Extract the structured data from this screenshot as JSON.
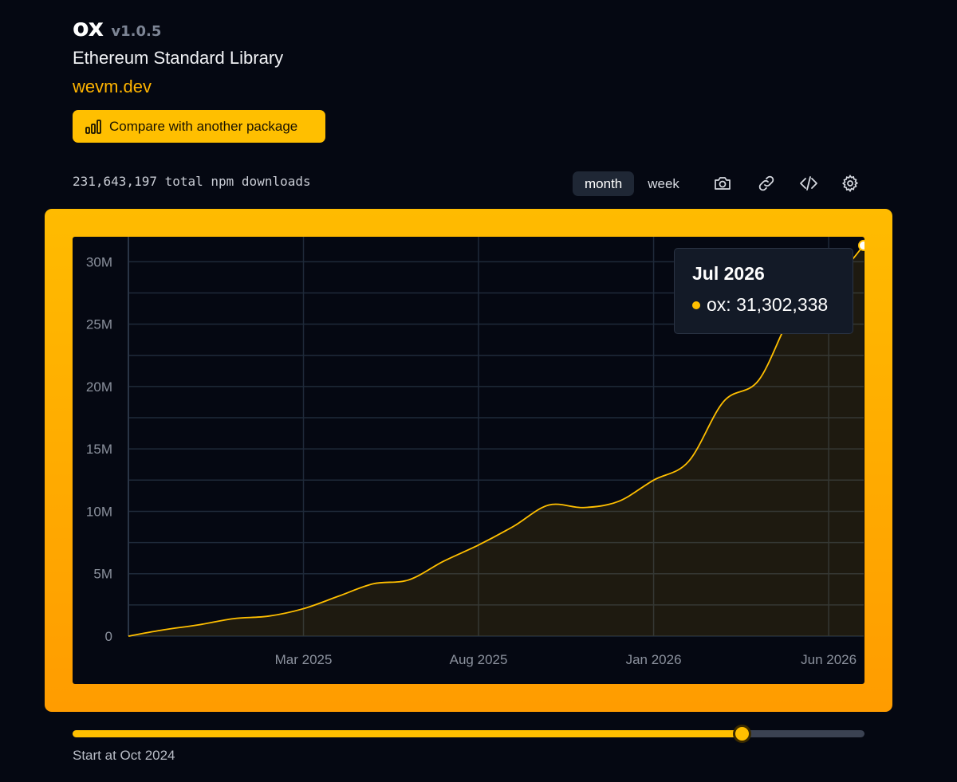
{
  "package": {
    "name": "ox",
    "version": "v1.0.5",
    "description": "Ethereum Standard Library",
    "homepage": "wevm.dev"
  },
  "compare_button": {
    "label": "Compare with another package",
    "icon": "bar-chart-icon"
  },
  "total_downloads": "231,643,197 total npm downloads",
  "period_toggle": {
    "options": [
      "month",
      "week"
    ],
    "selected": "month"
  },
  "toolbar_icons": [
    "camera-icon",
    "link-icon",
    "code-icon",
    "gear-icon"
  ],
  "colors": {
    "accent": "#ffbf00",
    "background": "#050812",
    "frame_top": "#ffbb00",
    "frame_bottom": "#ff9c00"
  },
  "tooltip": {
    "date": "Jul 2026",
    "series": "ox",
    "value": "31,302,338"
  },
  "slider": {
    "label": "Start at Oct 2024",
    "position": 0.845
  },
  "chart_data": {
    "type": "area",
    "series": [
      {
        "name": "ox",
        "x": [
          "Oct 2024",
          "Nov 2024",
          "Dec 2024",
          "Jan 2025",
          "Feb 2025",
          "Mar 2025",
          "Apr 2025",
          "May 2025",
          "Jun 2025",
          "Jul 2025",
          "Aug 2025",
          "Sep 2025",
          "Oct 2025",
          "Nov 2025",
          "Dec 2025",
          "Jan 2026",
          "Feb 2026",
          "Mar 2026",
          "Apr 2026",
          "May 2026",
          "Jun 2026",
          "Jul 2026"
        ],
        "values": [
          0,
          500000,
          900000,
          1400000,
          1600000,
          2200000,
          3200000,
          4200000,
          4500000,
          6000000,
          7300000,
          8800000,
          10500000,
          10300000,
          10800000,
          12500000,
          14000000,
          18800000,
          20500000,
          26000000,
          28000000,
          31302338
        ]
      }
    ],
    "y_ticks": [
      "0",
      "5M",
      "10M",
      "15M",
      "20M",
      "25M",
      "30M"
    ],
    "x_ticks": [
      "Mar 2025",
      "Aug 2025",
      "Jan 2026",
      "Jun 2026"
    ],
    "ylim": [
      0,
      32000000
    ],
    "grid": true
  }
}
